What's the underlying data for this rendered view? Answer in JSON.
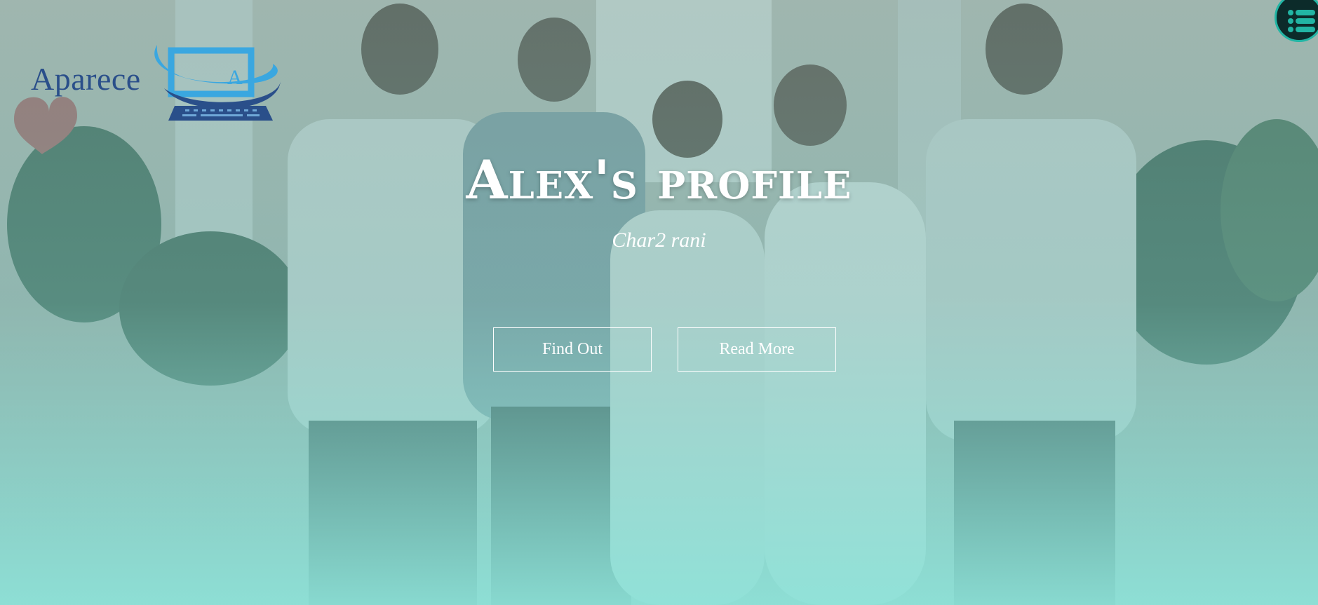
{
  "brand": {
    "name": "Aparece",
    "mark_letter": "A"
  },
  "hero": {
    "title": "Alex's profile",
    "subtitle": "Char2 rani"
  },
  "buttons": {
    "find_out": "Find Out",
    "read_more": "Read More"
  },
  "menu": {
    "icon": "list-menu-icon"
  },
  "colors": {
    "accent": "#22b5a4",
    "logo_blue": "#2a4f8a",
    "logo_light_blue": "#3aa7e0",
    "overlay_teal": "#8ce1d7"
  }
}
